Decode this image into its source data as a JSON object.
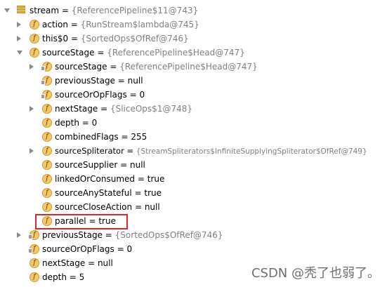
{
  "top_partial_text": "{ReferencePipeline$Head@747}",
  "rows": [
    {
      "name": "stream",
      "value": "{ReferencePipeline$11@743}",
      "ref": true,
      "icon": "stack"
    },
    {
      "name": "action",
      "value": "{RunStream$lambda@745}",
      "ref": true,
      "icon": "f"
    },
    {
      "name": "this$0",
      "value": "{SortedOps$OfRef@746}",
      "ref": true,
      "icon": "f"
    },
    {
      "name": "sourceStage",
      "value": "{ReferencePipeline$Head@747}",
      "ref": true,
      "icon": "f"
    },
    {
      "name": "sourceStage",
      "value": "{ReferencePipeline$Head@747}",
      "ref": true,
      "icon": "f-lock"
    },
    {
      "name": "previousStage",
      "value": "null",
      "ref": false,
      "icon": "f-lock"
    },
    {
      "name": "sourceOrOpFlags",
      "value": "0",
      "ref": false,
      "icon": "f-lock"
    },
    {
      "name": "nextStage",
      "value": "{SliceOps$1@748}",
      "ref": true,
      "icon": "f"
    },
    {
      "name": "depth",
      "value": "0",
      "ref": false,
      "icon": "f"
    },
    {
      "name": "combinedFlags",
      "value": "255",
      "ref": false,
      "icon": "f"
    },
    {
      "name": "sourceSpliterator",
      "value": "{StreamSpliterators$InfiniteSupplyingSpliterator$OfRef@749}",
      "ref": true,
      "icon": "f"
    },
    {
      "name": "sourceSupplier",
      "value": "null",
      "ref": false,
      "icon": "f"
    },
    {
      "name": "linkedOrConsumed",
      "value": "true",
      "ref": false,
      "icon": "f"
    },
    {
      "name": "sourceAnyStateful",
      "value": "true",
      "ref": false,
      "icon": "f"
    },
    {
      "name": "sourceCloseAction",
      "value": "null",
      "ref": false,
      "icon": "f"
    },
    {
      "name": "parallel",
      "value": "true",
      "ref": false,
      "icon": "f"
    },
    {
      "name": "previousStage",
      "value": "{SortedOps$OfRef@746}",
      "ref": true,
      "icon": "f-lock"
    },
    {
      "name": "sourceOrOpFlags",
      "value": "0",
      "ref": false,
      "icon": "f-lock"
    },
    {
      "name": "nextStage",
      "value": "null",
      "ref": false,
      "icon": "f"
    },
    {
      "name": "depth",
      "value": "5",
      "ref": false,
      "icon": "f"
    }
  ],
  "icon_letter": "f",
  "equals_sign": " = ",
  "watermark": "CSDN @秃了也弱了。",
  "colors": {
    "highlight_border": "#d9272d",
    "field_icon": "#f3c86c",
    "ref_text": "#808080"
  }
}
